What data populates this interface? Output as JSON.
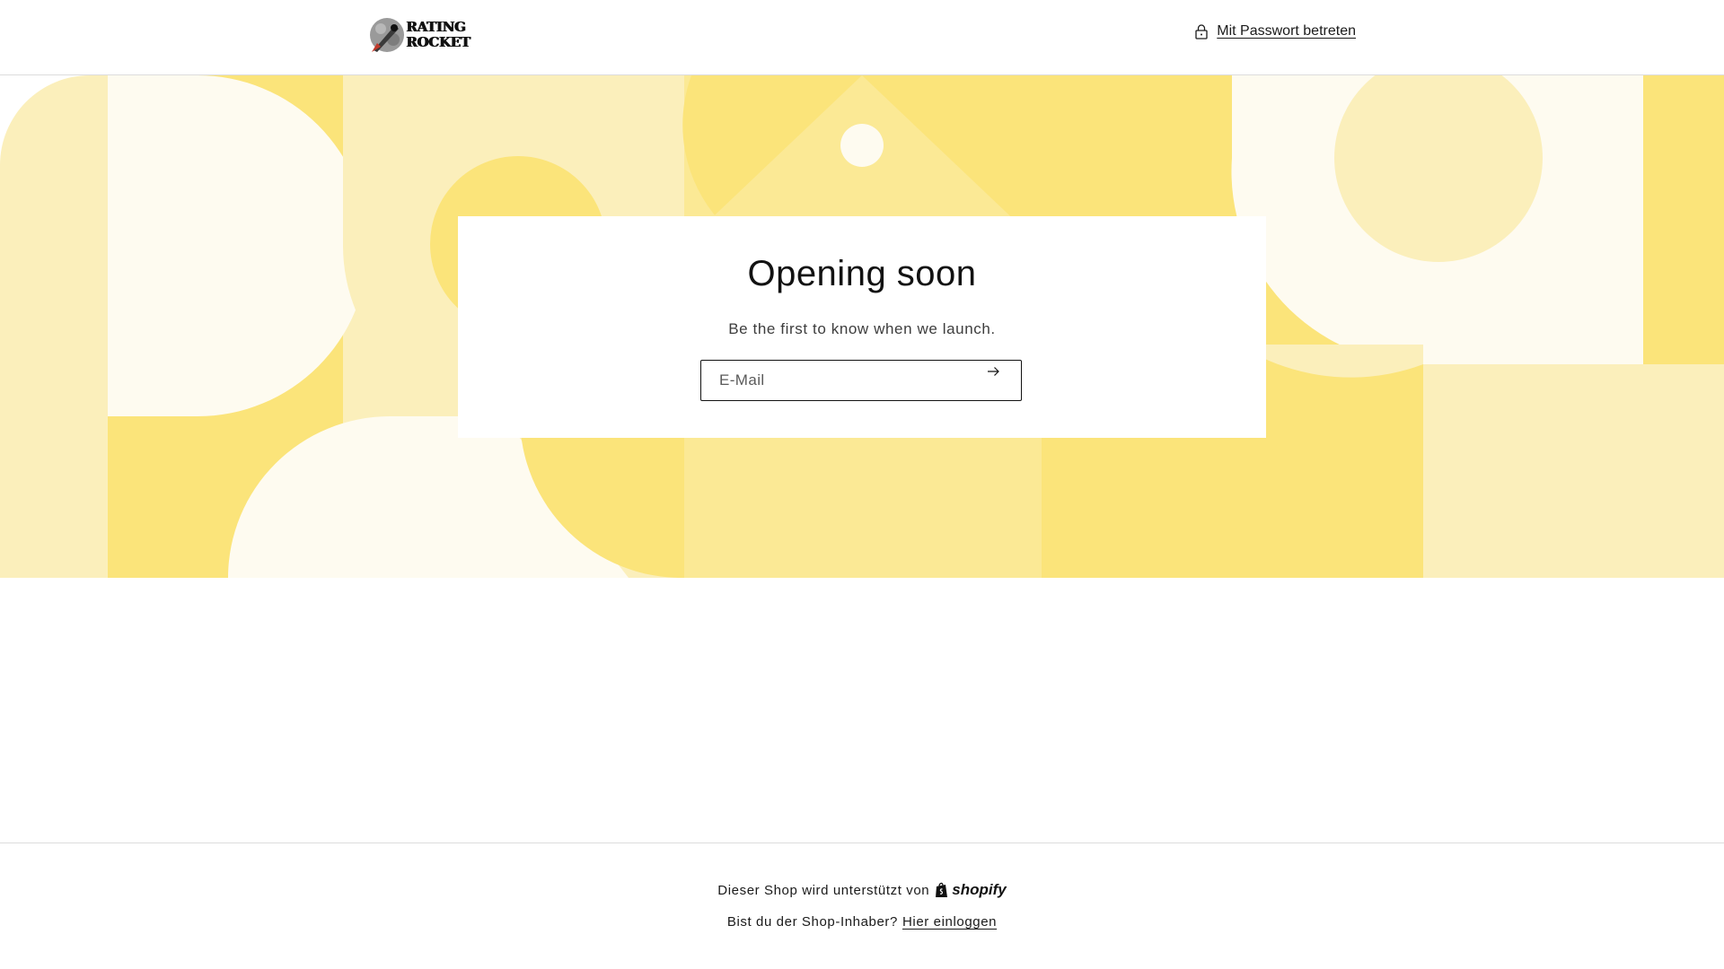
{
  "header": {
    "logo_line1": "RATING",
    "logo_line2": "ROCKET",
    "password_link": "Mit Passwort betreten"
  },
  "main": {
    "title": "Opening soon",
    "subtitle": "Be the first to know when we launch.",
    "email_placeholder": "E-Mail"
  },
  "footer": {
    "powered_by": "Dieser Shop wird unterstützt von",
    "shopify_label": "shopify",
    "owner_question": "Bist du der Shop-Inhaber?",
    "login_link": "Hier einloggen"
  },
  "colors": {
    "pale": "#fbefbb",
    "cream": "#fefbf0",
    "yellow": "#fbe47a",
    "mid": "#fbe995"
  }
}
